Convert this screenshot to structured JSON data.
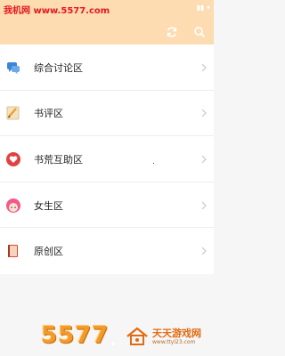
{
  "watermark_top": {
    "text": "我机网 www.5577.com"
  },
  "header": {
    "refresh_icon": "refresh-icon",
    "search_icon": "search-icon"
  },
  "sections": [
    {
      "label": "综合讨论区",
      "icon": "chat-bubbles-icon",
      "accent": "#3b86d9"
    },
    {
      "label": "书评区",
      "icon": "pencil-note-icon",
      "accent": "#e8a030"
    },
    {
      "label": "书荒互助区",
      "icon": "heart-circle-icon",
      "accent": "#e34141"
    },
    {
      "label": "女生区",
      "icon": "girl-face-icon",
      "accent": "#f25a8a"
    },
    {
      "label": "原创区",
      "icon": "book-icon",
      "accent": "#d84a2e"
    }
  ],
  "watermark_bottom": {
    "number": "5577",
    "dot": ".",
    "site_name": "天天游戏网",
    "url": "www.ttyl23.com"
  },
  "colors": {
    "header_bg": "#fcdcb0",
    "list_bg": "#ffffff",
    "page_bg": "#f6f6f6"
  }
}
